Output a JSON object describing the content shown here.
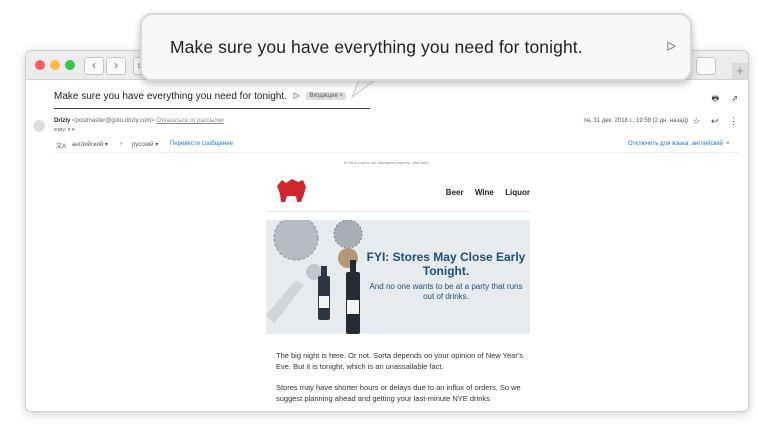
{
  "email": {
    "subject": "Make sure you have everything you need for tonight.",
    "label_badge": "Входящие ×",
    "sender_name": "Drizly",
    "sender_email": "<postmaster@goto.drizly.com>",
    "unsubscribe": "Отказаться от рассылки",
    "to": "кому: я ▾",
    "date": "пн, 31 дек. 2018 г., 19:59 (2 дн. назад)"
  },
  "translate_bar": {
    "from_lang": "английский ▾",
    "arrow": "›",
    "to_lang": "русский ▾",
    "translate_link": "Перевести сообщение",
    "disable_link": "Отключить для языка: английский",
    "close": "×"
  },
  "notice": "If this e-mail is not displayed properly, click here.",
  "newsletter": {
    "nav": [
      "Beer",
      "Wine",
      "Liquor"
    ],
    "hero_title": "FYI: Stores May Close Early Tonight.",
    "hero_sub": "And no one wants to be at a party that runs out of drinks.",
    "paragraph1": "The big night is here. Or not. Sorta depends on your opinion of New Year's Eve. But it is tonight, which is an unassailable fact.",
    "paragraph2": "Stores may have shorter hours or delays due to an influx of orders. So we suggest planning ahead and getting your last-minute NYE drinks"
  },
  "zoom_callout": {
    "text": "Make sure you have everything you need for tonight."
  },
  "browser": {
    "back": "‹",
    "forward": "›",
    "new_tab": "+"
  },
  "colors": {
    "hero_text": "#1f4e79",
    "link": "#1a73e8",
    "brand": "#d2262f"
  },
  "icons": [
    "print-icon",
    "open-in-new-icon",
    "star-icon",
    "reply-icon",
    "more-icon",
    "important-marker-icon",
    "translate-icon"
  ]
}
